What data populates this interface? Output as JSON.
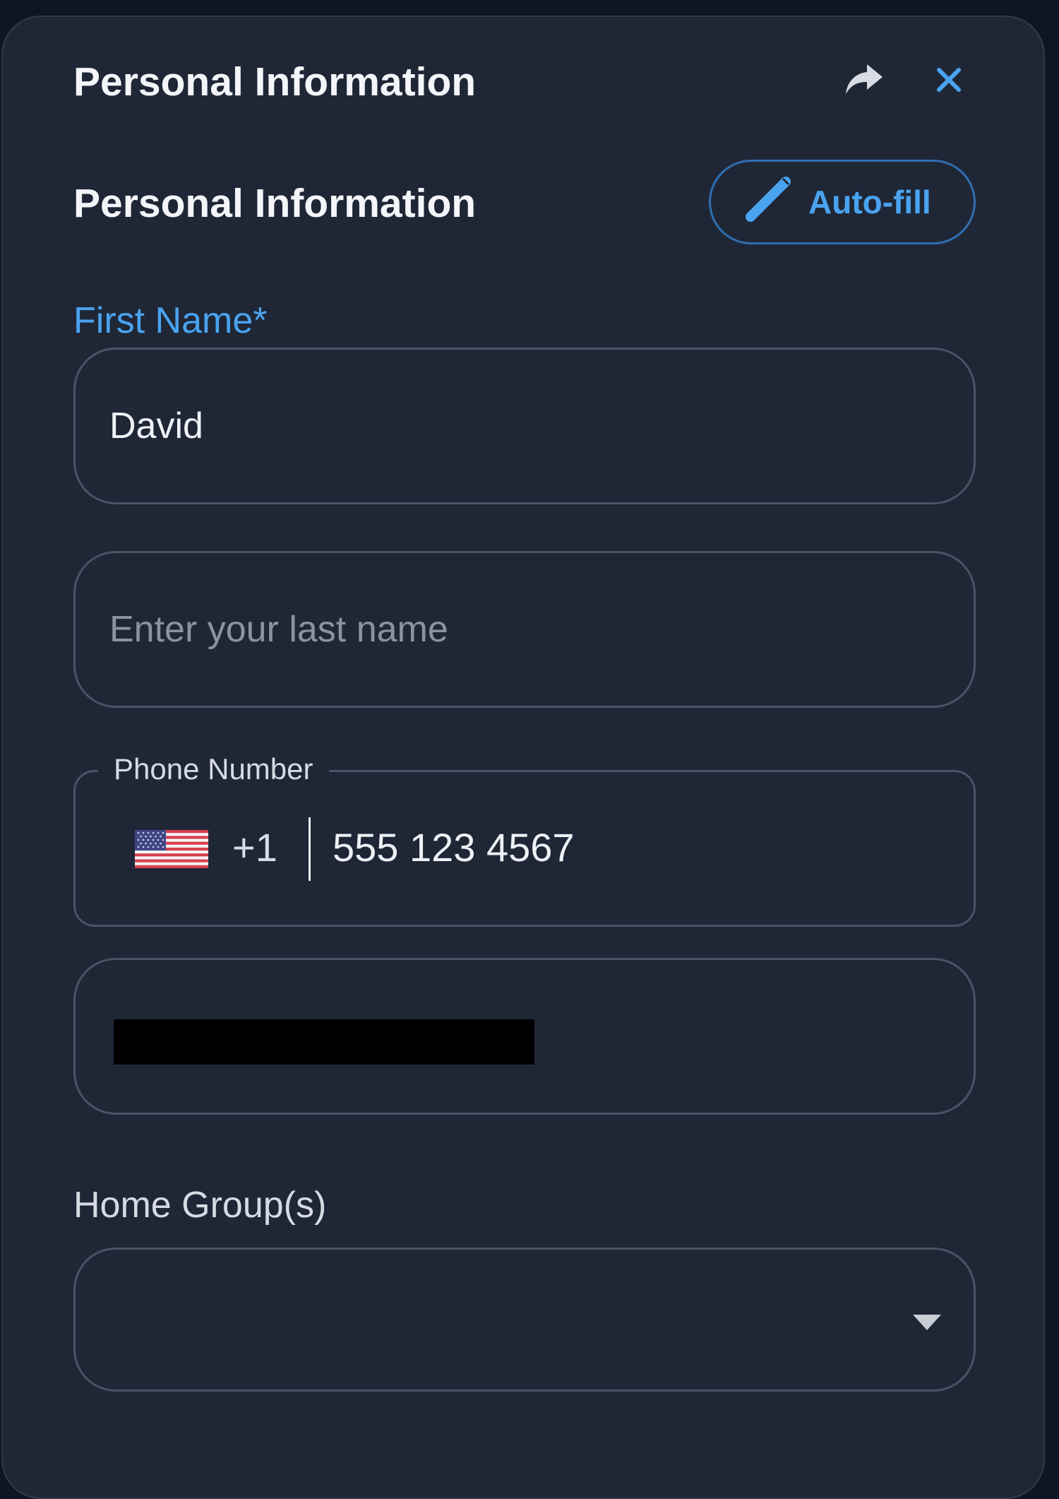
{
  "header": {
    "title": "Personal Information",
    "share_icon": "share-icon",
    "close_icon": "close-icon"
  },
  "section": {
    "title": "Personal Information",
    "autofill_label": "Auto-fill",
    "autofill_icon": "pen-icon"
  },
  "first_name": {
    "label": "First Name*",
    "value": "David"
  },
  "last_name": {
    "placeholder": "Enter your last name",
    "value": ""
  },
  "phone": {
    "legend": "Phone Number",
    "country_flag": "us-flag-icon",
    "dial_code": "+1",
    "value": "555 123 4567"
  },
  "home_groups": {
    "label": "Home Group(s)",
    "selected": ""
  },
  "colors": {
    "panel_bg": "#1f2736",
    "page_bg": "#0f1623",
    "accent": "#4aa3f0",
    "field_border": "#4a5364"
  }
}
